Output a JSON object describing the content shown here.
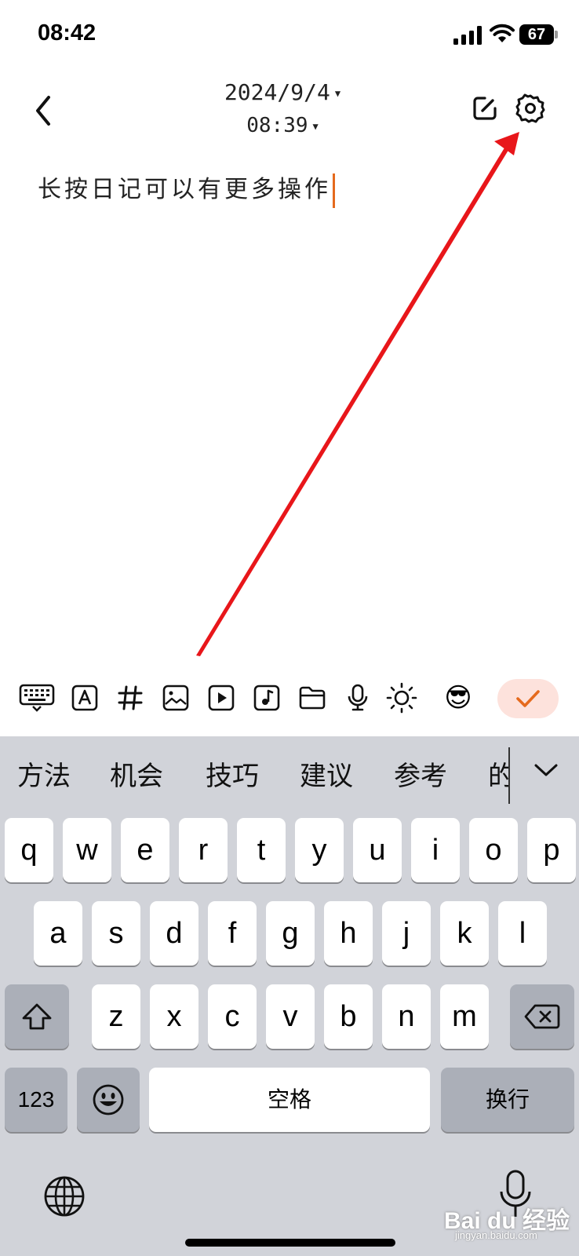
{
  "status_bar": {
    "time": "08:42",
    "battery_level": "67",
    "icons": [
      "signal-icon",
      "wifi-icon",
      "battery-icon"
    ]
  },
  "header": {
    "date": "2024/9/4",
    "time": "08:39",
    "icons": [
      "back-icon",
      "edit-icon",
      "gear-icon"
    ]
  },
  "editor": {
    "content": "长按日记可以有更多操作",
    "cursor_color": "#e56a1d"
  },
  "annotation": {
    "arrow_color": "#e8161a",
    "points_to": "gear-icon"
  },
  "toolbar": {
    "tools": [
      "keyboard-icon",
      "font-icon",
      "hashtag-icon",
      "image-icon",
      "video-icon",
      "music-icon",
      "folder-icon",
      "mic-icon",
      "brightness-icon",
      "sunglasses-emoji"
    ],
    "emoji": "😎",
    "confirm_color": "#fde2dc",
    "confirm_check_color": "#e56a1d"
  },
  "keyboard": {
    "candidates": [
      "方法",
      "机会",
      "技巧",
      "建议",
      "参考",
      "的"
    ],
    "row1": [
      "q",
      "w",
      "e",
      "r",
      "t",
      "y",
      "u",
      "i",
      "o",
      "p"
    ],
    "row2": [
      "a",
      "s",
      "d",
      "f",
      "g",
      "h",
      "j",
      "k",
      "l"
    ],
    "row3": [
      "z",
      "x",
      "c",
      "v",
      "b",
      "n",
      "m"
    ],
    "numbers_label": "123",
    "space_label": "空格",
    "return_label": "换行",
    "background": "#d1d3d9"
  },
  "watermark": {
    "main": "Bai du 经验",
    "sub": "jingyan.baidu.com"
  }
}
